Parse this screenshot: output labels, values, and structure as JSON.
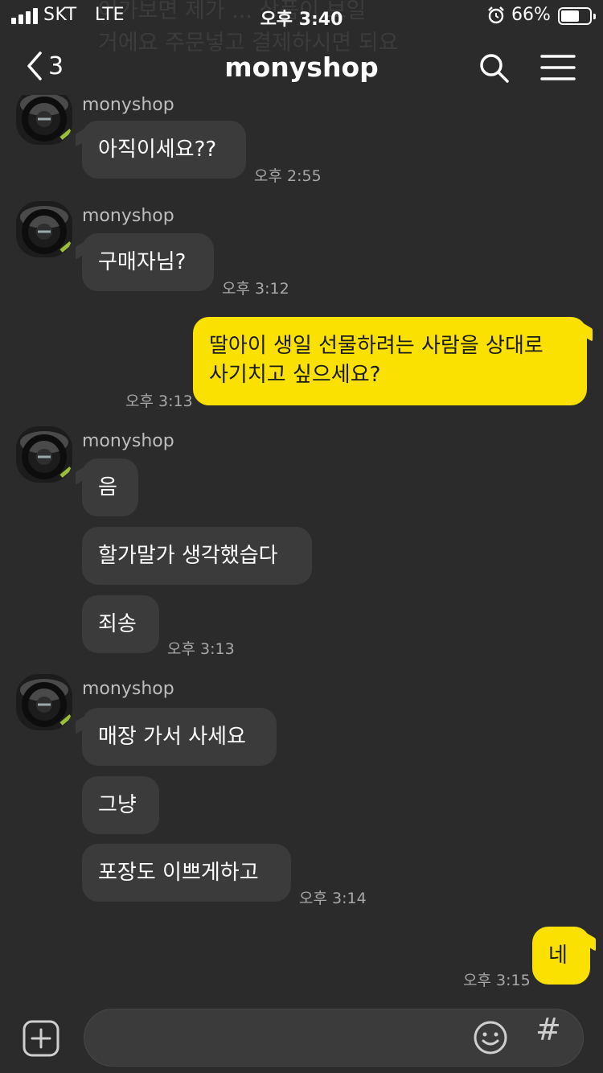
{
  "status": {
    "carrier": "SKT",
    "network": "LTE",
    "time": "오후 3:40",
    "battery_pct": "66%",
    "battery_level": 0.66,
    "icons": [
      "signal-icon",
      "alarm-icon",
      "battery-icon"
    ]
  },
  "header": {
    "back_count": "3",
    "title": "monyshop",
    "ghost_lines": [
      "어가보면 제가 ... 상품이 보일",
      "거에요 주문넣고 결제하시면 되요"
    ],
    "icons": [
      "back-chevron-icon",
      "search-icon",
      "menu-icon"
    ]
  },
  "messages": [
    {
      "sender": "monyshop",
      "bubbles": [
        "아직이세요??"
      ],
      "time": "오후 2:55"
    },
    {
      "sender": "monyshop",
      "bubbles": [
        "구매자님?"
      ],
      "time": "오후 3:12"
    },
    {
      "mine": true,
      "bubbles": [
        "딸아이 생일 선물하려는 사람을 상대로\n사기치고 싶으세요?"
      ],
      "time": "오후 3:13"
    },
    {
      "sender": "monyshop",
      "bubbles": [
        "음",
        "할가말가 생각했습다",
        "죄송"
      ],
      "time": "오후 3:13"
    },
    {
      "sender": "monyshop",
      "bubbles": [
        "매장 가서 사세요",
        "그냥",
        "포장도 이쁘게하고"
      ],
      "time": "오후 3:14"
    },
    {
      "mine": true,
      "bubbles": [
        "네"
      ],
      "time": "오후 3:15"
    }
  ],
  "input_bar": {
    "icons": [
      "plus-icon",
      "emoji-icon",
      "hashtag-icon"
    ],
    "hash_symbol": "#"
  },
  "colors": {
    "background": "#2b2b2b",
    "incoming_bubble": "#3b3b3b",
    "outgoing_bubble": "#fbe101"
  }
}
